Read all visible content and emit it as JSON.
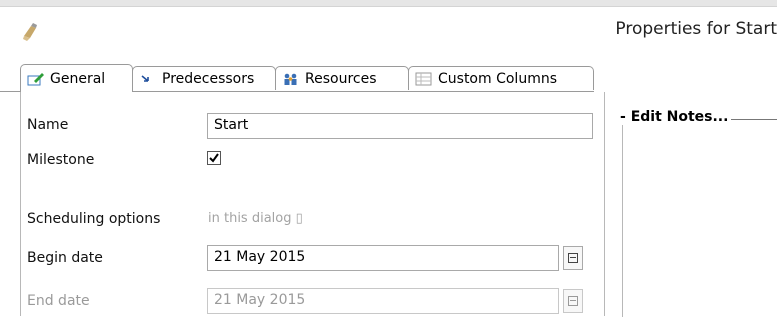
{
  "window": {
    "title": "Properties for Start",
    "icon": "app-icon"
  },
  "tabs": [
    {
      "label": "General",
      "icon": "edit-icon",
      "active": true
    },
    {
      "label": "Predecessors",
      "icon": "predecessor-icon",
      "active": false
    },
    {
      "label": "Resources",
      "icon": "resources-icon",
      "active": false
    },
    {
      "label": "Custom Columns",
      "icon": "table-icon",
      "active": false
    }
  ],
  "form": {
    "name_label": "Name",
    "name_value": "Start",
    "milestone_label": "Milestone",
    "milestone_checked": true,
    "scheduling_label": "Scheduling options",
    "scheduling_hint": "in this dialog ▯",
    "begin_label": "Begin date",
    "begin_value": "21 May 2015",
    "end_label": "End date",
    "end_value": "21 May 2015"
  },
  "notes": {
    "legend": "Edit Notes..."
  },
  "colors": {
    "border": "#a9a9a9",
    "disabled_text": "#9a9a9a"
  }
}
